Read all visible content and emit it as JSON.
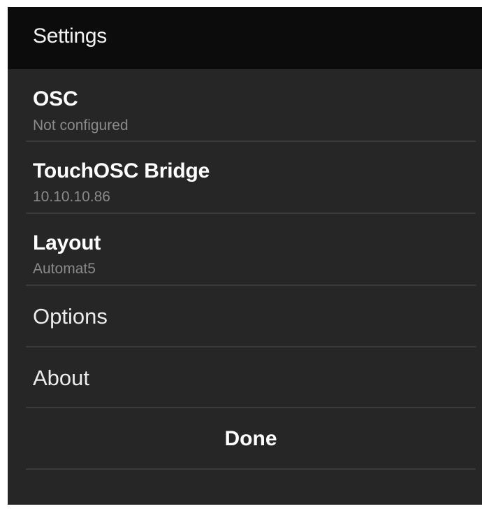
{
  "header": {
    "title": "Settings"
  },
  "settings_items": [
    {
      "label": "OSC",
      "value": "Not configured"
    },
    {
      "label": "TouchOSC Bridge",
      "value": "10.10.10.86"
    },
    {
      "label": "Layout",
      "value": "Automat5"
    },
    {
      "label": "Options"
    },
    {
      "label": "About"
    }
  ],
  "footer": {
    "done_label": "Done"
  },
  "colors": {
    "title_bar": "#0c0c0c",
    "background": "#262626",
    "primary_text": "#ffffff",
    "secondary_text": "#8a8a8a",
    "divider": "#3a3a3a"
  }
}
